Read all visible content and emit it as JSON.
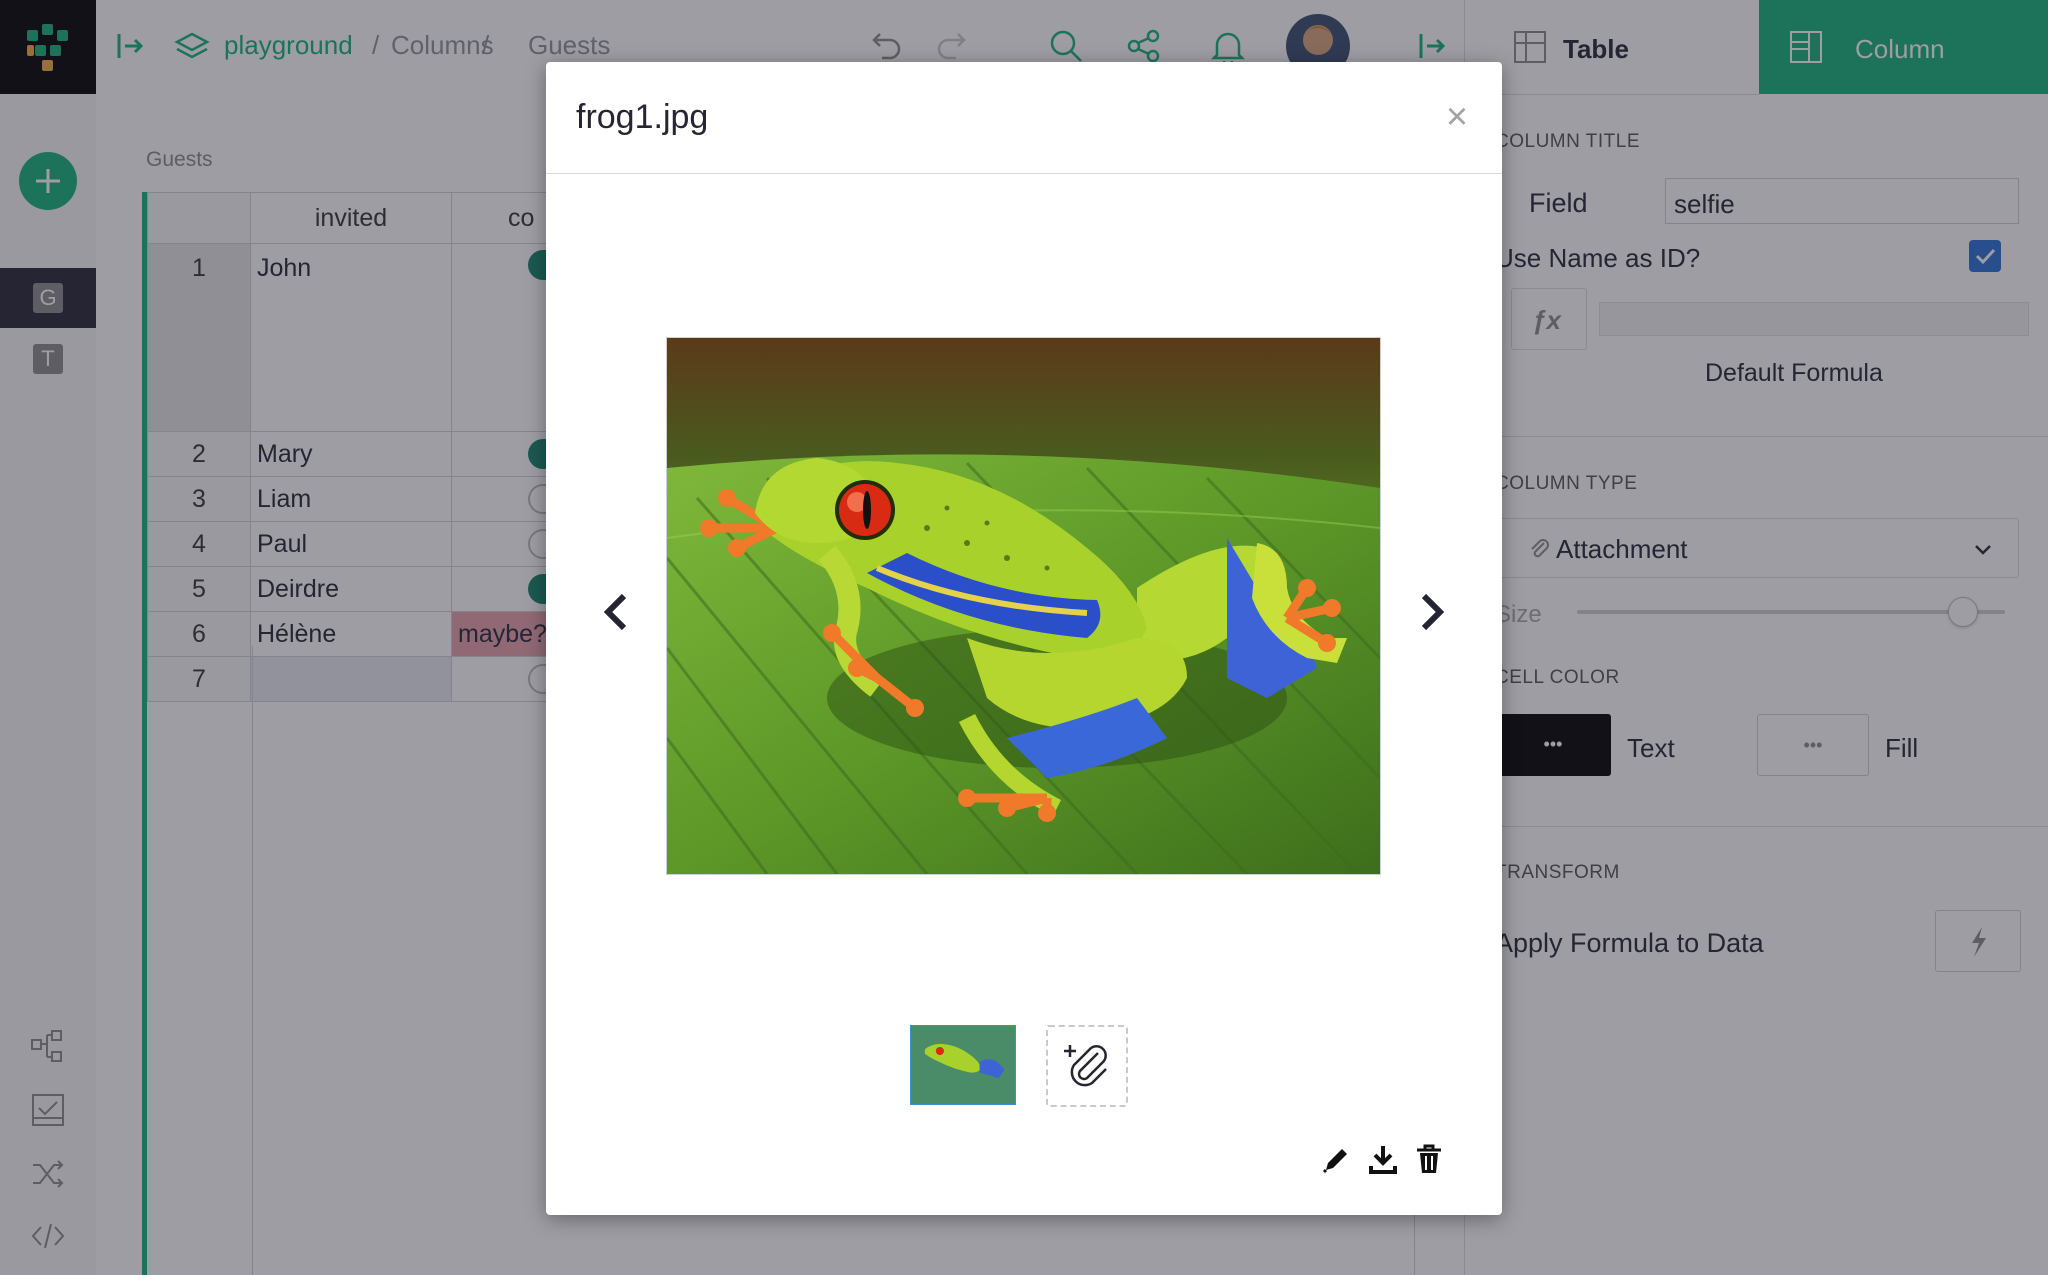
{
  "breadcrumb": {
    "workspace": "playground",
    "sep1": "/",
    "doc": "Columns",
    "sep2": "/",
    "page": "Guests"
  },
  "sidebar": {
    "pages": [
      {
        "initial": "G",
        "active": true
      },
      {
        "initial": "T",
        "active": false
      }
    ],
    "bottom_icons": [
      "raw-data-icon",
      "validate-icon",
      "shuffle-icon",
      "code-icon"
    ]
  },
  "grid": {
    "section_title": "Guests",
    "columns": [
      "invited",
      "co"
    ],
    "rows": [
      {
        "num": "1",
        "invited": "John",
        "second": "toggle-on"
      },
      {
        "num": "2",
        "invited": "Mary",
        "second": "toggle-on"
      },
      {
        "num": "3",
        "invited": "Liam",
        "second": "toggle-off"
      },
      {
        "num": "4",
        "invited": "Paul",
        "second": "toggle-off"
      },
      {
        "num": "5",
        "invited": "Deirdre",
        "second": "toggle-on"
      },
      {
        "num": "6",
        "invited": "Hélène",
        "second": "maybe?"
      },
      {
        "num": "7",
        "invited": "",
        "second": "toggle-off"
      }
    ]
  },
  "right_panel": {
    "tab_table": "Table",
    "tab_column": "Column",
    "column_title_caption": "COLUMN TITLE",
    "field_label": "Field",
    "field_value": "selfie",
    "use_name_as_id_label": "Use Name as ID?",
    "use_name_as_id_checked": true,
    "fx_label": "ƒx",
    "default_formula_label": "Default Formula",
    "column_type_caption": "COLUMN TYPE",
    "column_type_value": "Attachment",
    "size_label": "Size",
    "size_value_fraction": 0.86,
    "cell_color_caption": "CELL COLOR",
    "text_color_btn": "•••",
    "text_label": "Text",
    "fill_color_btn": "•••",
    "fill_label": "Fill",
    "transform_caption": "TRANSFORM",
    "apply_formula_label": "Apply Formula to Data"
  },
  "modal": {
    "title": "frog1.jpg",
    "close_label": "×"
  },
  "colors": {
    "accent_green": "#16b378",
    "dark_green": "#14836b",
    "checkbox_blue": "#2b6fd8",
    "maybe_pink": "#e8a0aa"
  }
}
